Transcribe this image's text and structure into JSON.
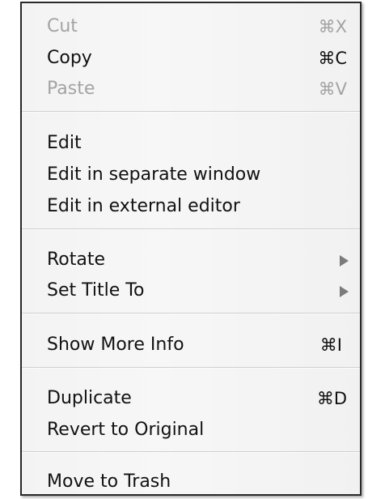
{
  "menu": {
    "cut": {
      "label": "Cut",
      "shortcut": "⌘X"
    },
    "copy": {
      "label": "Copy",
      "shortcut": "⌘C"
    },
    "paste": {
      "label": "Paste",
      "shortcut": "⌘V"
    },
    "edit": {
      "label": "Edit"
    },
    "edit_separate": {
      "label": "Edit in separate window"
    },
    "edit_external": {
      "label": "Edit in external editor"
    },
    "rotate": {
      "label": "Rotate",
      "arrow_icon": "submenu-arrow-icon"
    },
    "set_title": {
      "label": "Set Title To",
      "arrow_icon": "submenu-arrow-icon"
    },
    "show_info": {
      "label": "Show More Info",
      "shortcut": "⌘I"
    },
    "duplicate": {
      "label": "Duplicate",
      "shortcut": "⌘D"
    },
    "revert": {
      "label": "Revert to Original"
    },
    "trash": {
      "label": "Move to Trash"
    }
  },
  "colors": {
    "enabled_text": "#111111",
    "disabled_text": "#a3a3a3",
    "menu_background": "#f4f4f4",
    "border": "#2a2a2a",
    "arrow": "#7b7b7b"
  }
}
